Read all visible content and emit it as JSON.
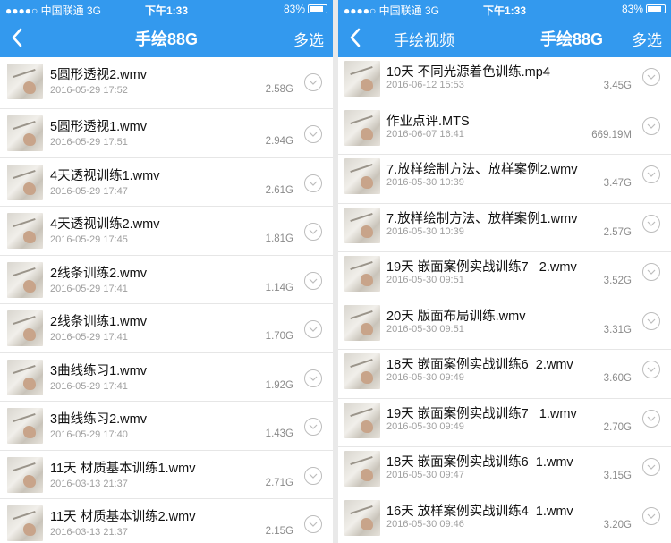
{
  "left": {
    "status": {
      "carrier": "●●●●○ 中国联通",
      "network": "3G",
      "time": "下午1:33",
      "battery": "83%"
    },
    "nav": {
      "title": "手绘88G",
      "right": "多选"
    },
    "files": [
      {
        "name": "5圆形透视2.wmv",
        "date": "2016-05-29 17:52",
        "size": "2.58G"
      },
      {
        "name": "5圆形透视1.wmv",
        "date": "2016-05-29 17:51",
        "size": "2.94G"
      },
      {
        "name": "4天透视训练1.wmv",
        "date": "2016-05-29 17:47",
        "size": "2.61G"
      },
      {
        "name": "4天透视训练2.wmv",
        "date": "2016-05-29 17:45",
        "size": "1.81G"
      },
      {
        "name": "2线条训练2.wmv",
        "date": "2016-05-29 17:41",
        "size": "1.14G"
      },
      {
        "name": "2线条训练1.wmv",
        "date": "2016-05-29 17:41",
        "size": "1.70G"
      },
      {
        "name": "3曲线练习1.wmv",
        "date": "2016-05-29 17:41",
        "size": "1.92G"
      },
      {
        "name": "3曲线练习2.wmv",
        "date": "2016-05-29 17:40",
        "size": "1.43G"
      },
      {
        "name": "11天 材质基本训练1.wmv",
        "date": "2016-03-13 21:37",
        "size": "2.71G"
      },
      {
        "name": "11天 材质基本训练2.wmv",
        "date": "2016-03-13 21:37",
        "size": "2.15G"
      }
    ]
  },
  "right": {
    "status": {
      "carrier": "●●●●○ 中国联通",
      "network": "3G",
      "time": "下午1:33",
      "battery": "83%"
    },
    "nav": {
      "subtitle": "手绘视频",
      "title": "手绘88G",
      "right": "多选"
    },
    "files": [
      {
        "name": "10天 不同光源着色训练.mp4",
        "date": "2016-06-12 15:53",
        "size": "3.45G"
      },
      {
        "name": "作业点评.MTS",
        "date": "2016-06-07 16:41",
        "size": "669.19M"
      },
      {
        "name": "7.放样绘制方法、放样案例2.wmv",
        "date": "2016-05-30 10:39",
        "size": "3.47G"
      },
      {
        "name": "7.放样绘制方法、放样案例1.wmv",
        "date": "2016-05-30 10:39",
        "size": "2.57G"
      },
      {
        "name": "19天 嵌面案例实战训练7   2.wmv",
        "date": "2016-05-30 09:51",
        "size": "3.52G"
      },
      {
        "name": "20天 版面布局训练.wmv",
        "date": "2016-05-30 09:51",
        "size": "3.31G"
      },
      {
        "name": "18天 嵌面案例实战训练6  2.wmv",
        "date": "2016-05-30 09:49",
        "size": "3.60G"
      },
      {
        "name": "19天 嵌面案例实战训练7   1.wmv",
        "date": "2016-05-30 09:49",
        "size": "2.70G"
      },
      {
        "name": "18天 嵌面案例实战训练6  1.wmv",
        "date": "2016-05-30 09:47",
        "size": "3.15G"
      },
      {
        "name": "16天 放样案例实战训练4  1.wmv",
        "date": "2016-05-30 09:46",
        "size": "3.20G"
      }
    ]
  },
  "icons": {
    "back": "chevron-left-icon",
    "more": "chevron-down-circle-icon",
    "thumb": "video-thumbnail-icon",
    "battery": "battery-icon"
  },
  "colors": {
    "nav_bg": "#3399ee",
    "text": "#111111",
    "meta": "#a0a0a0"
  }
}
